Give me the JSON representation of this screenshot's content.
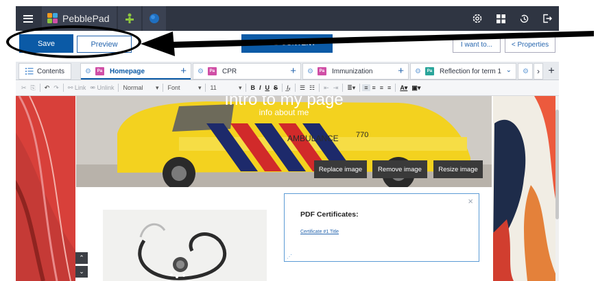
{
  "app": {
    "name": "PebblePad"
  },
  "actions": {
    "save": "Save",
    "preview": "Preview",
    "add_content": "+ ADD CONTENT",
    "i_want_to": "I want to...",
    "properties": "< Properties"
  },
  "tabs": {
    "contents": "Contents",
    "items": [
      {
        "label": "Homepage",
        "badge": "Pa",
        "badge_color": "#d04fa6"
      },
      {
        "label": "CPR",
        "badge": "Pa",
        "badge_color": "#d04fa6"
      },
      {
        "label": "Immunization",
        "badge": "Pa",
        "badge_color": "#d04fa6"
      },
      {
        "label": "Reflection for term 1",
        "badge": "Pa",
        "badge_color": "#2aa59b"
      }
    ],
    "more": "›",
    "add": "+"
  },
  "toolbar": {
    "link": "Link",
    "unlink": "Unlink",
    "format": "Normal",
    "font": "Font",
    "size": "11"
  },
  "hero": {
    "title": "Intro to my page",
    "subtitle": "info about me",
    "vehicle_text": "AMBULANCE",
    "vehicle_number": "770",
    "replace": "Replace image",
    "remove": "Remove image",
    "resize": "Resize image"
  },
  "textbox": {
    "heading": "PDF Certificates:",
    "link": "Certificate #1 Title",
    "close": "×"
  },
  "colors": {
    "topbar": "#2f3542",
    "primary": "#0b5aa6",
    "textbox_border": "#5b9bd5"
  }
}
